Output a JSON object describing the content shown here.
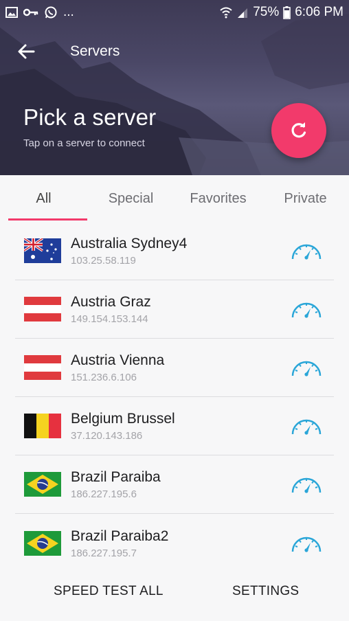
{
  "status_bar": {
    "dots": "...",
    "battery": "75%",
    "time": "6:06 PM"
  },
  "appbar": {
    "title": "Servers"
  },
  "hero": {
    "title": "Pick a server",
    "subtitle": "Tap on a server to connect"
  },
  "tabs": [
    {
      "label": "All",
      "active": true
    },
    {
      "label": "Special",
      "active": false
    },
    {
      "label": "Favorites",
      "active": false
    },
    {
      "label": "Private",
      "active": false
    }
  ],
  "servers": [
    {
      "name": "Australia Sydney4",
      "ip": "103.25.58.119",
      "flag": "australia"
    },
    {
      "name": "Austria Graz",
      "ip": "149.154.153.144",
      "flag": "austria"
    },
    {
      "name": "Austria Vienna",
      "ip": "151.236.6.106",
      "flag": "austria"
    },
    {
      "name": "Belgium Brussel",
      "ip": "37.120.143.186",
      "flag": "belgium"
    },
    {
      "name": "Brazil Paraiba",
      "ip": "186.227.195.6",
      "flag": "brazil"
    },
    {
      "name": "Brazil Paraiba2",
      "ip": "186.227.195.7",
      "flag": "brazil"
    }
  ],
  "actions": {
    "speed_test_all": "SPEED TEST ALL",
    "settings": "SETTINGS"
  },
  "colors": {
    "accent": "#f23a6b",
    "speed_icon": "#2aa6d8",
    "header": "#4a4766"
  },
  "icons": {
    "back": "arrow-left-icon",
    "refresh": "refresh-icon",
    "speed": "speedometer-icon"
  }
}
